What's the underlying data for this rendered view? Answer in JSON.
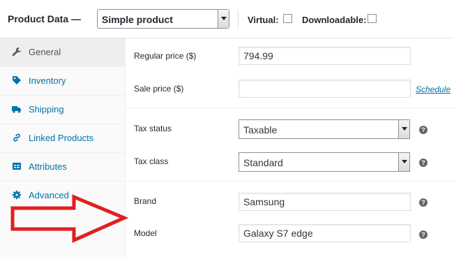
{
  "header": {
    "title": "Product Data —",
    "product_type": "Simple product",
    "virtual_label": "Virtual:",
    "downloadable_label": "Downloadable:"
  },
  "sidebar": {
    "tabs": [
      {
        "label": "General",
        "icon": "wrench-icon"
      },
      {
        "label": "Inventory",
        "icon": "tag-icon"
      },
      {
        "label": "Shipping",
        "icon": "truck-icon"
      },
      {
        "label": "Linked Products",
        "icon": "link-icon"
      },
      {
        "label": "Attributes",
        "icon": "list-icon"
      },
      {
        "label": "Advanced",
        "icon": "gear-icon"
      }
    ]
  },
  "general": {
    "regular_price_label": "Regular price ($)",
    "regular_price_value": "794.99",
    "sale_price_label": "Sale price ($)",
    "sale_price_value": "",
    "schedule_link": "Schedule",
    "tax_status_label": "Tax status",
    "tax_status_value": "Taxable",
    "tax_class_label": "Tax class",
    "tax_class_value": "Standard",
    "brand_label": "Brand",
    "brand_value": "Samsung",
    "model_label": "Model",
    "model_value": "Galaxy S7 edge",
    "help_glyph": "?"
  },
  "colors": {
    "link": "#0073aa",
    "annotation_arrow": "#e02020"
  }
}
